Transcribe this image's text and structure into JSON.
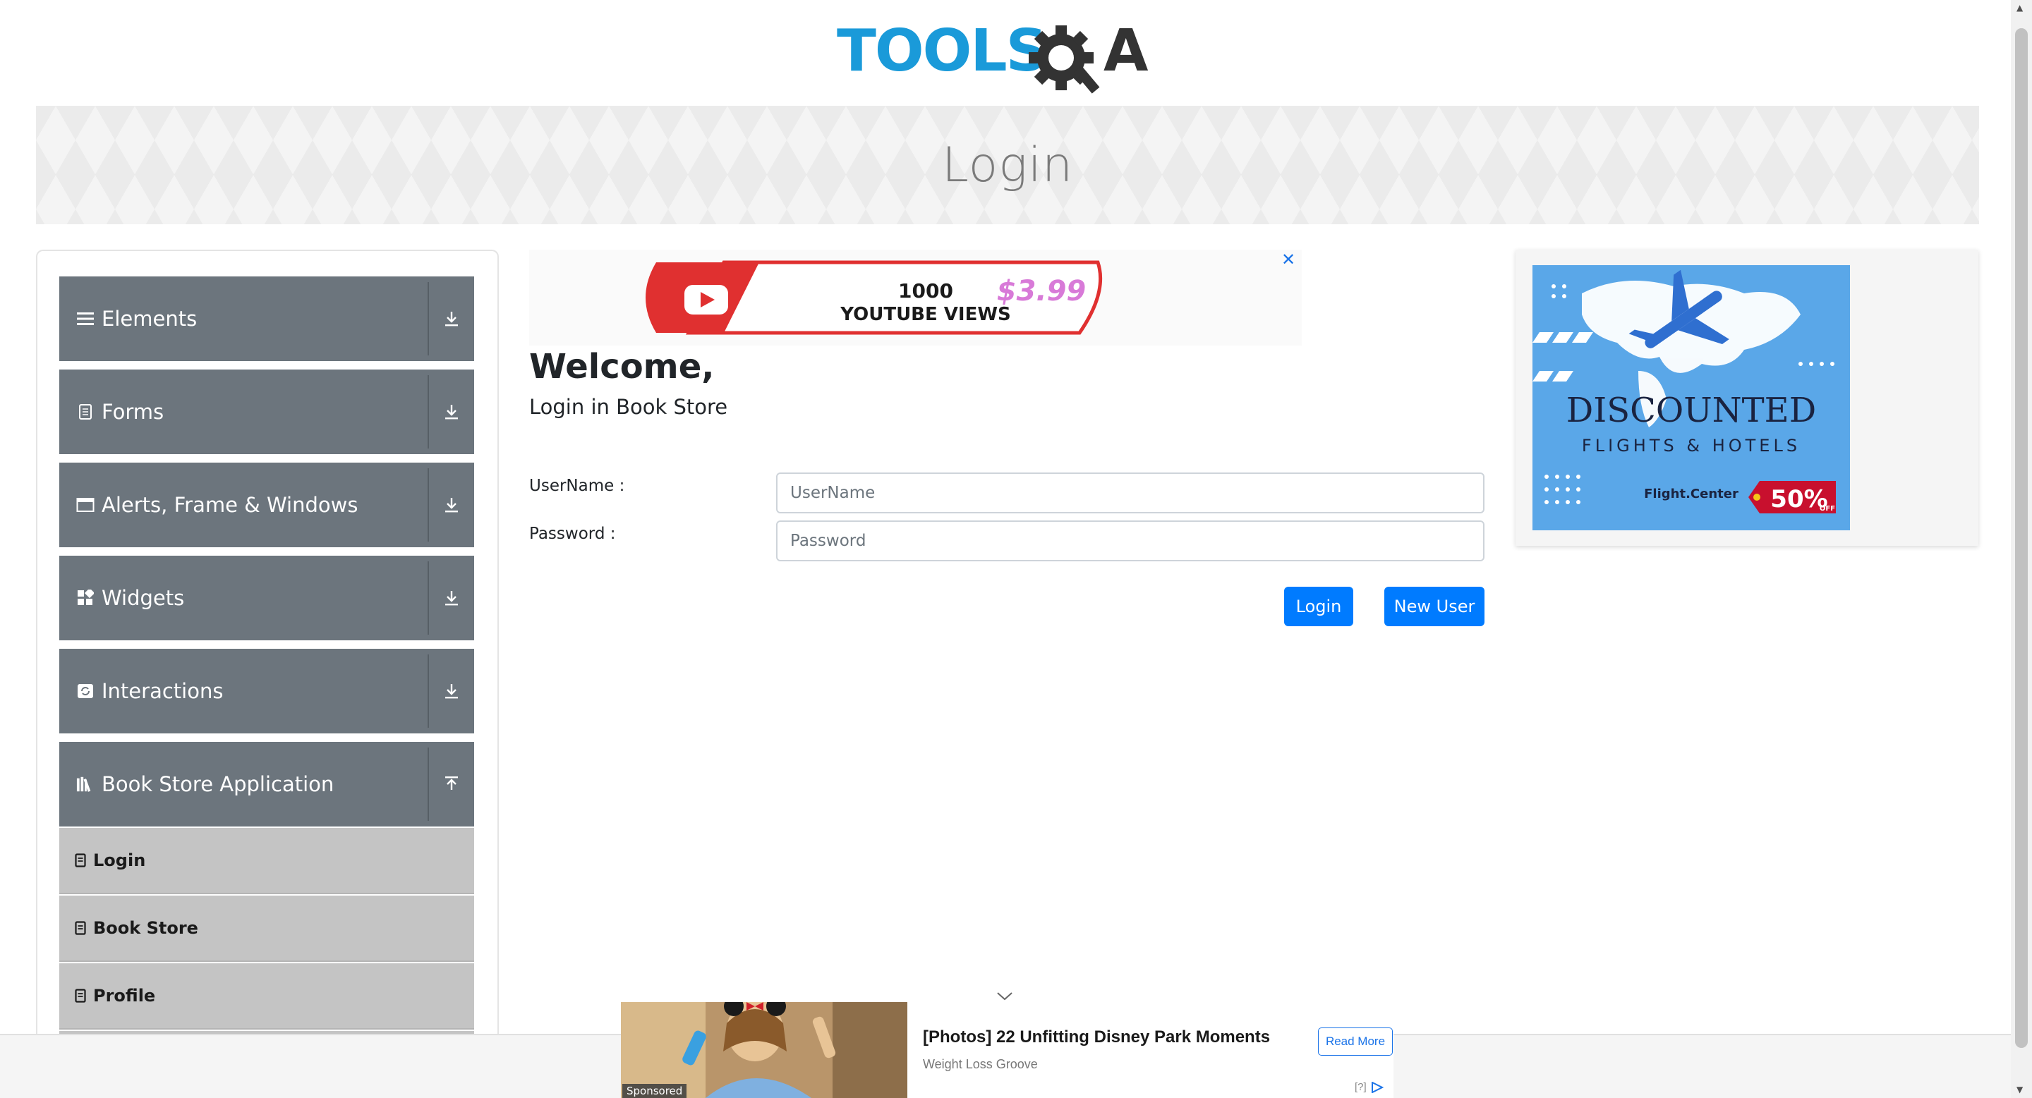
{
  "brand": {
    "logo_text_left": "TOOLS",
    "logo_text_right": "A"
  },
  "banner": {
    "title": "Login"
  },
  "sidebar": {
    "groups": [
      {
        "label": "Elements",
        "icon": "list-icon",
        "expanded": false
      },
      {
        "label": "Forms",
        "icon": "document-icon",
        "expanded": false
      },
      {
        "label": "Alerts, Frame & Windows",
        "icon": "window-icon",
        "expanded": false
      },
      {
        "label": "Widgets",
        "icon": "widgets-icon",
        "expanded": false
      },
      {
        "label": "Interactions",
        "icon": "interactions-icon",
        "expanded": false
      },
      {
        "label": "Book Store Application",
        "icon": "books-icon",
        "expanded": true
      }
    ],
    "book_store_items": [
      {
        "label": "Login"
      },
      {
        "label": "Book Store"
      },
      {
        "label": "Profile"
      }
    ]
  },
  "main": {
    "welcome": "Welcome,",
    "subtitle": "Login in Book Store",
    "username_label": "UserName :",
    "username_placeholder": "UserName",
    "username_value": "",
    "password_label": "Password :",
    "password_placeholder": "Password",
    "password_value": "",
    "login_button": "Login",
    "new_user_button": "New User"
  },
  "ads": {
    "top": {
      "line1": "1000",
      "line2": "YOUTUBE VIEWS",
      "price": "$3.99",
      "close": "✕"
    },
    "right": {
      "headline": "DISCOUNTED",
      "subline": "FLIGHTS & HOTELS",
      "brand": "Flight.Center",
      "discount": "50%",
      "discount_suffix": "OFF",
      "close": "✕"
    },
    "bottom": {
      "title": "[Photos] 22 Unfitting Disney Park Moments",
      "source": "Weight Loss Groove",
      "cta": "Read More",
      "sponsored": "Sponsored",
      "info": "[?]"
    }
  },
  "colors": {
    "sidebar_header": "#6c757d",
    "sidebar_sub": "#c4c4c4",
    "primary_button": "#007bff",
    "logo_blue": "#1a9ad9",
    "logo_dark": "#333333"
  }
}
